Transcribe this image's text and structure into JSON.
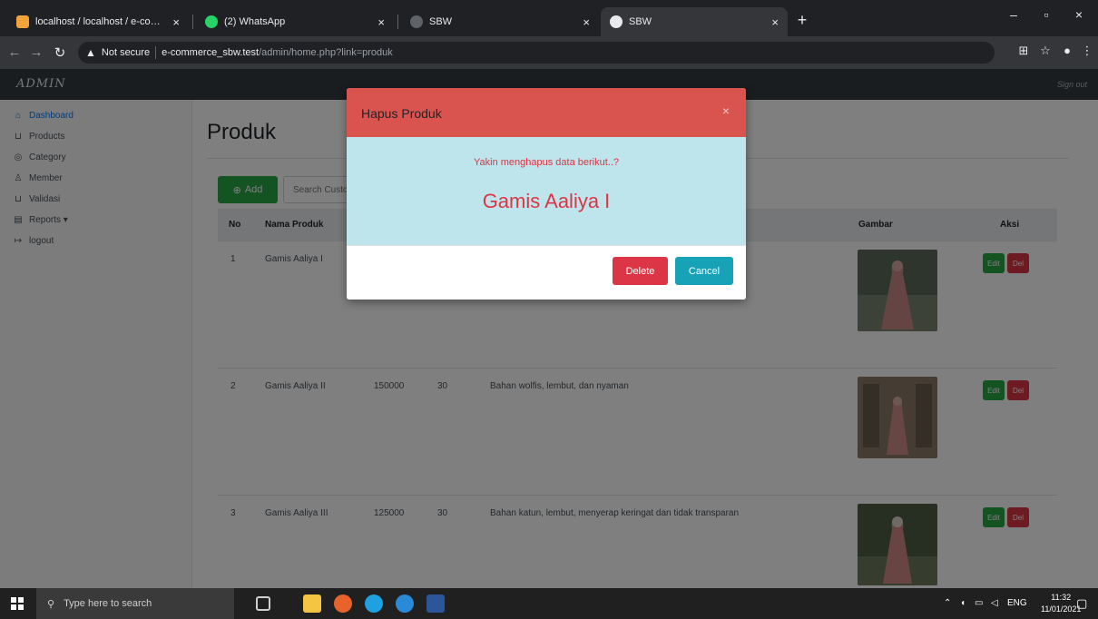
{
  "browser": {
    "tabs": [
      {
        "title": "localhost / localhost / e-comme"
      },
      {
        "title": "(2) WhatsApp"
      },
      {
        "title": "SBW"
      },
      {
        "title": "SBW"
      }
    ],
    "security_label": "Not secure",
    "url_host": "e-commerce_sbw.test",
    "url_path": "/admin/home.php?link=produk"
  },
  "app": {
    "brand": "ADMIN",
    "sign_out": "Sign out"
  },
  "sidebar": {
    "items": [
      {
        "label": "Dashboard",
        "icon": "home-icon"
      },
      {
        "label": "Products",
        "icon": "cart-icon"
      },
      {
        "label": "Category",
        "icon": "tag-icon"
      },
      {
        "label": "Member",
        "icon": "users-icon"
      },
      {
        "label": "Validasi",
        "icon": "check-icon"
      },
      {
        "label": "Reports ▾",
        "icon": "report-icon"
      },
      {
        "label": "logout",
        "icon": "logout-icon"
      }
    ]
  },
  "main": {
    "title": "Produk",
    "add_label": "Add",
    "search_placeholder": "Search Customer"
  },
  "table": {
    "headers": [
      "No",
      "Nama Produk",
      "Gambar",
      "Aksi"
    ],
    "edit_label": "Edit",
    "del_label": "Del",
    "rows": [
      {
        "no": "1",
        "name": "Gamis Aaliya I",
        "price": "",
        "stock": "",
        "desc": ""
      },
      {
        "no": "2",
        "name": "Gamis Aaliya II",
        "price": "150000",
        "stock": "30",
        "desc": "Bahan wolfis, lembut, dan nyaman"
      },
      {
        "no": "3",
        "name": "Gamis Aaliya III",
        "price": "125000",
        "stock": "30",
        "desc": "Bahan katun, lembut, menyerap keringat dan tidak transparan"
      }
    ]
  },
  "modal": {
    "title": "Hapus Produk",
    "close": "×",
    "message": "Yakin menghapus data berikut..?",
    "product_name": "Gamis Aaliya I",
    "delete_label": "Delete",
    "cancel_label": "Cancel"
  },
  "taskbar": {
    "search_placeholder": "Type here to search",
    "lang": "ENG",
    "time": "11:32",
    "date": "11/01/2021"
  }
}
